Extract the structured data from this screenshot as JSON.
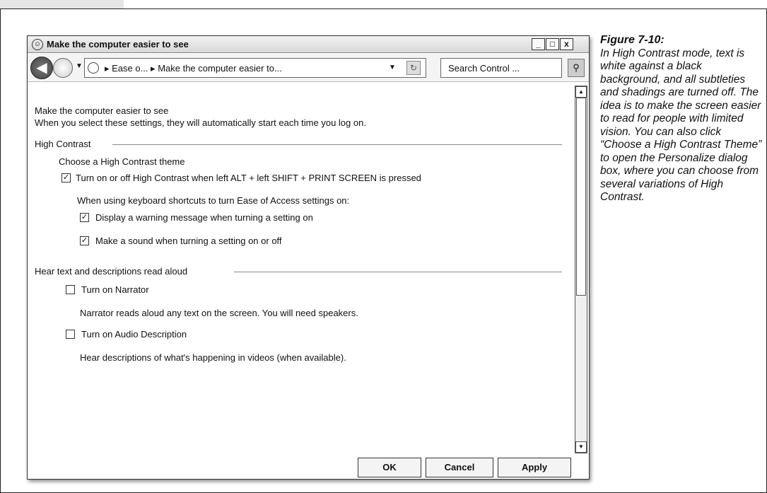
{
  "window": {
    "title": "Make the computer easier to see",
    "min_label": "_",
    "max_label": "□",
    "close_label": "x"
  },
  "navbar": {
    "back_glyph": "◀",
    "address_text": "▸ Ease o... ▸ Make the computer easier to...",
    "search_placeholder": "Search Control ...",
    "search_glyph": "⚲",
    "refresh_glyph": "↻",
    "dropdown_glyph": "▼"
  },
  "content": {
    "heading": "Make the computer easier to see",
    "intro": "When you select these settings, they will automatically start each time you log on.",
    "high_contrast": {
      "section": "High Contrast",
      "choose_theme": "Choose a High Contrast theme",
      "toggle_label": "Turn on or off High Contrast when left ALT + left SHIFT + PRINT SCREEN is pressed",
      "toggle_checked": true,
      "shortcuts_note": "When using keyboard shortcuts to turn Ease of Access settings on:",
      "warning_label": "Display a warning message when turning a setting on",
      "warning_checked": true,
      "sound_label": "Make a sound when turning a setting on or off",
      "sound_checked": true
    },
    "read_aloud": {
      "section": "Hear text and descriptions read aloud",
      "narrator_label": "Turn on Narrator",
      "narrator_checked": false,
      "narrator_desc": "Narrator reads aloud any text on the screen. You will need speakers.",
      "audio_label": "Turn on Audio Description",
      "audio_checked": false,
      "audio_desc": "Hear descriptions of what's happening in videos (when available)."
    }
  },
  "buttons": {
    "ok": "OK",
    "cancel": "Cancel",
    "apply": "Apply"
  },
  "caption": {
    "title": "Figure 7-10:",
    "body": "In High Contrast mode, text is white against a black background, and all subtleties and shadings are turned off. The idea is to make the screen easier to read for people with limited vision. You can also click “Choose a High Contrast Theme” to open the Personalize dialog box, where you can choose from several variations of High Contrast."
  },
  "checkmark": "✓"
}
